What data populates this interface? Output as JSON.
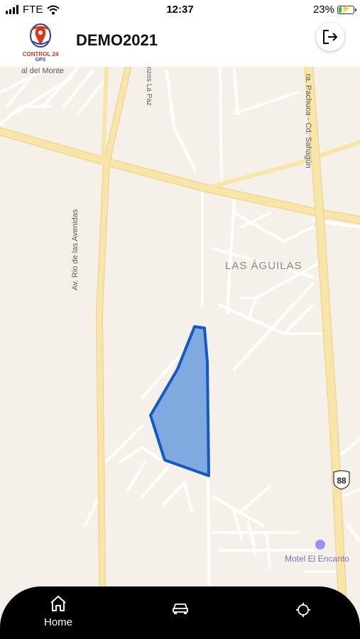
{
  "status_bar": {
    "carrier": "FTE",
    "time": "12:37",
    "battery_percent": "23%",
    "battery_level": 0.23
  },
  "header": {
    "logo_text_line1": "CONTROL 24",
    "logo_text_line2": "GPS",
    "title": "DEMO2021",
    "logout_icon": "logout-icon"
  },
  "map": {
    "labels": {
      "neighborhood": "LAS ÁGUILAS",
      "avenue": "Av. Rio de las Avenidas",
      "highway": "ra. Pachuca - Cd. Sahagún",
      "street_top_left": "al del Monte",
      "street_top": "ozos La Paz",
      "poi": "Motel El Encanto",
      "highway_shield": "88"
    },
    "colors": {
      "background": "#f6f1e8",
      "major_road": "#f8e6a8",
      "minor_road": "#ffffff",
      "geofence_fill": "#7fa9df",
      "geofence_stroke": "#1459c4",
      "poi": "#7a6fcf"
    }
  },
  "bottom_nav": {
    "items": [
      {
        "icon": "home-icon",
        "label": "Home"
      },
      {
        "icon": "car-icon",
        "label": ""
      },
      {
        "icon": "crosshair-icon",
        "label": ""
      }
    ]
  }
}
